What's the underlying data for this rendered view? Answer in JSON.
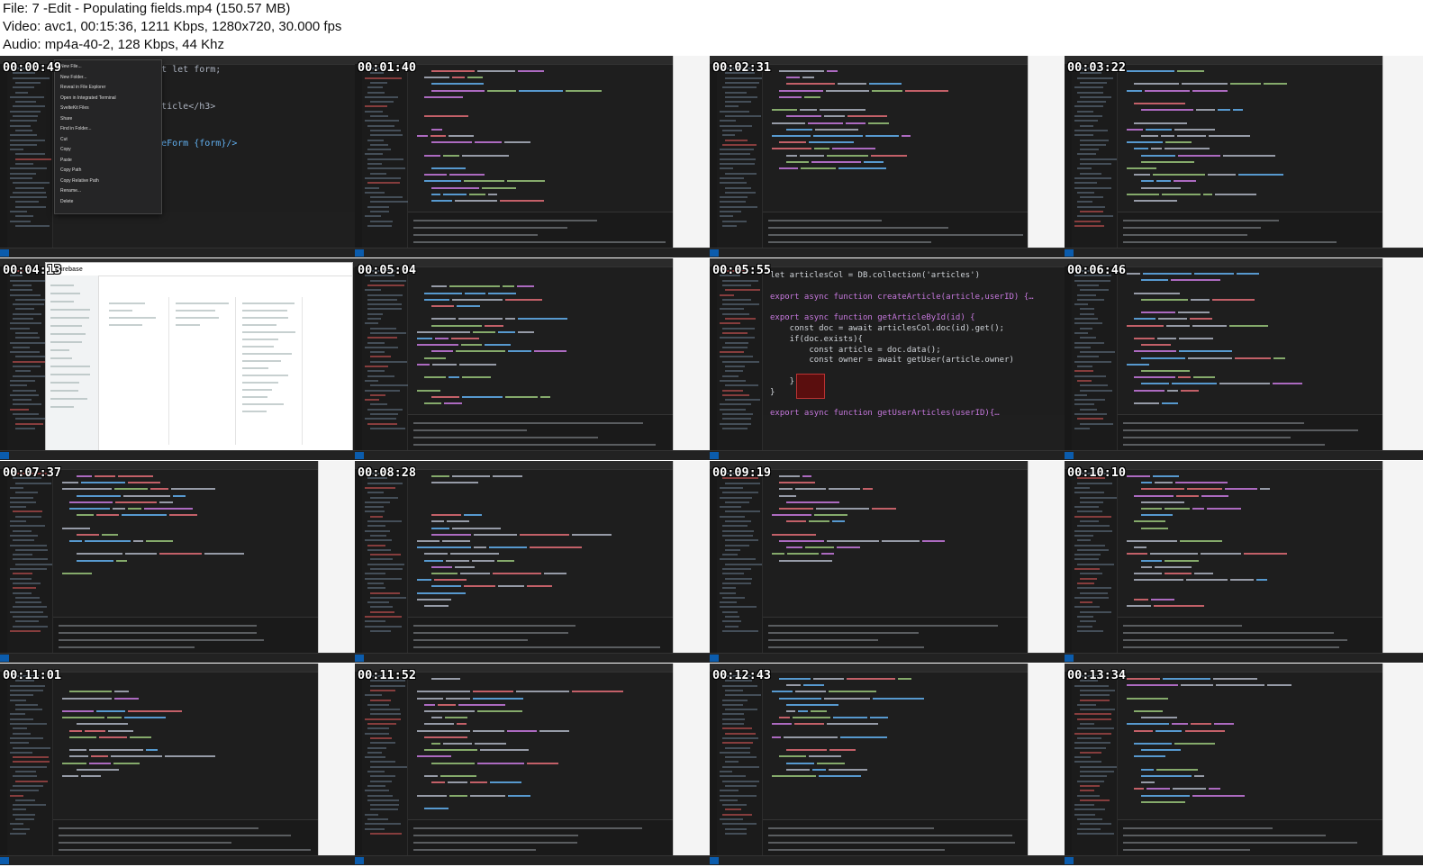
{
  "header": {
    "file_line": "File: 7 -Edit  - Populating fields.mp4 (150.57 MB)",
    "video_line": "Video: avc1, 00:15:36, 1211 Kbps, 1280x720, 30.000 fps",
    "audio_line": "Audio: mp4a-40-2, 128 Kbps, 44 Khz"
  },
  "thumbnails": [
    {
      "time": "00:00:49",
      "kind": "context-menu"
    },
    {
      "time": "00:01:40",
      "kind": "editor"
    },
    {
      "time": "00:02:31",
      "kind": "editor"
    },
    {
      "time": "00:03:22",
      "kind": "editor"
    },
    {
      "time": "00:04:13",
      "kind": "firebase"
    },
    {
      "time": "00:05:04",
      "kind": "editor"
    },
    {
      "time": "00:05:55",
      "kind": "editor-zoomed"
    },
    {
      "time": "00:06:46",
      "kind": "editor"
    },
    {
      "time": "00:07:37",
      "kind": "editor"
    },
    {
      "time": "00:08:28",
      "kind": "editor"
    },
    {
      "time": "00:09:19",
      "kind": "editor"
    },
    {
      "time": "00:10:10",
      "kind": "editor"
    },
    {
      "time": "00:11:01",
      "kind": "editor"
    },
    {
      "time": "00:11:52",
      "kind": "editor"
    },
    {
      "time": "00:12:43",
      "kind": "editor"
    },
    {
      "time": "00:13:34",
      "kind": "editor"
    }
  ],
  "context_menu": {
    "items": [
      "New File...",
      "New Folder...",
      "Reveal in File Explorer",
      "Open in Integrated Terminal",
      "SvelteKit Files",
      "Share",
      "Find in Folder...",
      "Cut",
      "Copy",
      "Paste",
      "Copy Path",
      "Copy Relative Path",
      "Rename...",
      "Delete"
    ],
    "code_lines": [
      "export let form;",
      "it article</h3>",
      "rticleForm {form}/>"
    ]
  },
  "firebase": {
    "title": "Firebase"
  },
  "zoomed_code": {
    "lines": [
      "let articlesCol = DB.collection('articles')",
      "",
      "export async function createArticle(article,userID) {…",
      "",
      "export async function getArticleById(id) {",
      "    const doc = await articlesCol.doc(id).get();",
      "    if(doc.exists){",
      "        const article = doc.data();",
      "        const owner = await getUser(article.owner)",
      "",
      "    }",
      "}",
      "",
      "export async function getUserArticles(userID){…"
    ]
  },
  "colors": {
    "editor_bg": "#1e1e1e",
    "keyword": "#c678dd",
    "function": "#61afef",
    "string": "#98c379",
    "variable": "#e06c75",
    "plain": "#abb2bf"
  }
}
